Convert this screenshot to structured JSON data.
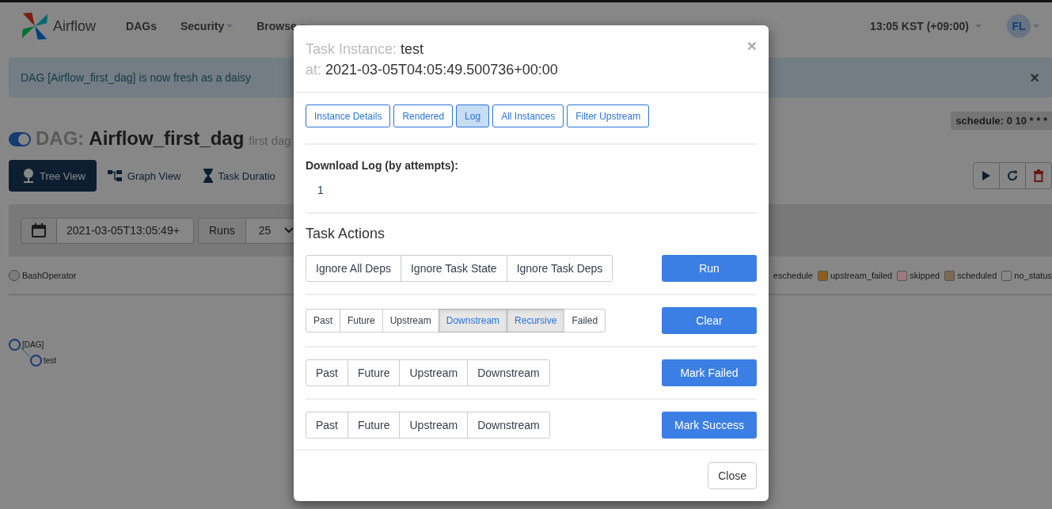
{
  "header": {
    "brand": "Airflow",
    "nav": [
      {
        "label": "DAGs",
        "dropdown": false
      },
      {
        "label": "Security",
        "dropdown": true
      },
      {
        "label": "Browse",
        "dropdown": true
      }
    ],
    "timezone": "13:05 KST (+09:00)",
    "user_initials": "FL"
  },
  "alert": {
    "message": "DAG [Airflow_first_dag] is now fresh as a daisy",
    "close": "×"
  },
  "dag": {
    "on": true,
    "prefix": "DAG:",
    "name": "Airflow_first_dag",
    "description": "first dag",
    "schedule": "schedule: 0 10 * * *"
  },
  "views": [
    {
      "label": "Tree View",
      "selected": true
    },
    {
      "label": "Graph View",
      "selected": false
    },
    {
      "label": "Task Duratio",
      "selected": false
    }
  ],
  "form": {
    "date": "2021-03-05T13:05:49+",
    "runs_label": "Runs",
    "runs": "25"
  },
  "operators": [
    {
      "name": "BashOperator"
    }
  ],
  "legend": [
    {
      "label": "eschedule"
    },
    {
      "label": "upstream_failed",
      "color": "#8e5e1e"
    },
    {
      "label": "skipped",
      "color": "#9e7a80"
    },
    {
      "label": "scheduled",
      "color": "#7d6a52"
    },
    {
      "label": "no_status",
      "color": "#888888"
    }
  ],
  "tree": [
    {
      "label": "[DAG]",
      "children": [
        {
          "label": "test"
        }
      ]
    }
  ],
  "modal": {
    "title_label": "Task Instance:",
    "task": "test",
    "at_label": "at:",
    "execution_date": "2021-03-05T04:05:49.500736+00:00",
    "close": "×",
    "tabs": [
      {
        "label": "Instance Details",
        "selected": false
      },
      {
        "label": "Rendered",
        "selected": false
      },
      {
        "label": "Log",
        "selected": true
      },
      {
        "label": "All Instances",
        "selected": false
      },
      {
        "label": "Filter Upstream",
        "selected": false
      }
    ],
    "log_heading": "Download Log (by attempts):",
    "attempts": [
      "1"
    ],
    "actions_heading": "Task Actions",
    "actions": [
      {
        "kind": "regular",
        "action": "Run",
        "options": [
          {
            "label": "Ignore All Deps",
            "selected": false
          },
          {
            "label": "Ignore Task State",
            "selected": false
          },
          {
            "label": "Ignore Task Deps",
            "selected": false
          }
        ]
      },
      {
        "kind": "compact",
        "action": "Clear",
        "options": [
          {
            "label": "Past",
            "selected": false
          },
          {
            "label": "Future",
            "selected": false
          },
          {
            "label": "Upstream",
            "selected": false
          },
          {
            "label": "Downstream",
            "selected": true
          },
          {
            "label": "Recursive",
            "selected": true
          },
          {
            "label": "Failed",
            "selected": false
          }
        ]
      },
      {
        "kind": "regular",
        "action": "Mark Failed",
        "options": [
          {
            "label": "Past",
            "selected": false
          },
          {
            "label": "Future",
            "selected": false
          },
          {
            "label": "Upstream",
            "selected": false
          },
          {
            "label": "Downstream",
            "selected": false
          }
        ]
      },
      {
        "kind": "regular",
        "action": "Mark Success",
        "options": [
          {
            "label": "Past",
            "selected": false
          },
          {
            "label": "Future",
            "selected": false
          },
          {
            "label": "Upstream",
            "selected": false
          },
          {
            "label": "Downstream",
            "selected": false
          }
        ]
      }
    ],
    "footer_button": "Close"
  }
}
